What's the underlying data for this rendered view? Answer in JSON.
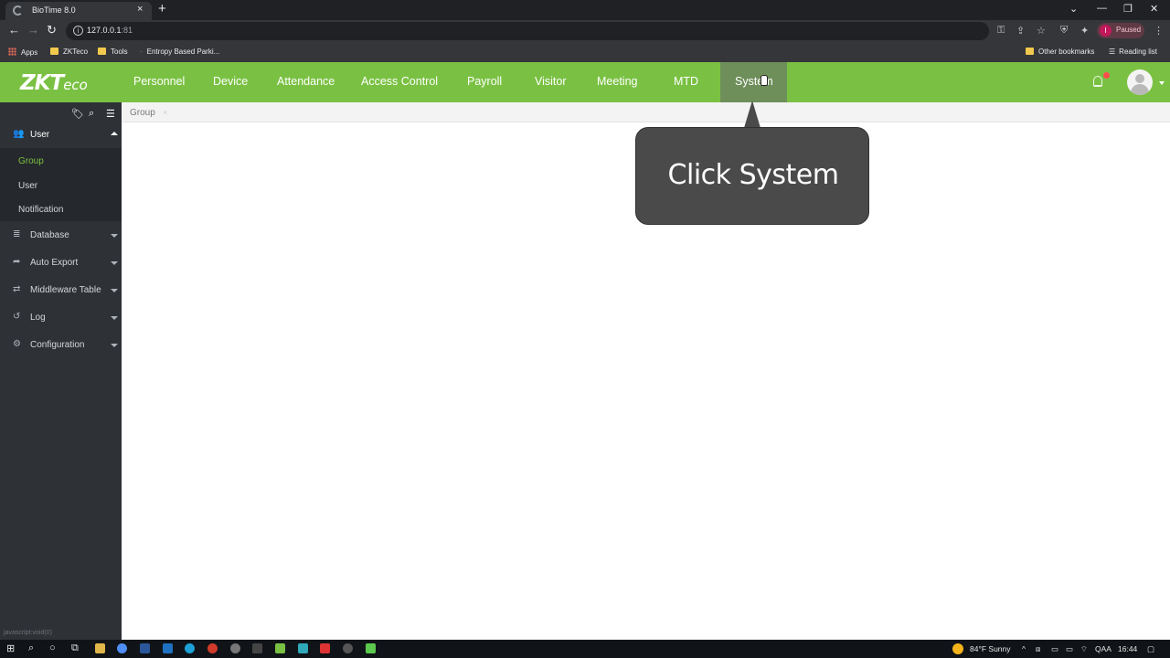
{
  "browser": {
    "tab_title": "BioTime 8.0",
    "tab_close": "×",
    "new_tab": "+",
    "url": "127.0.0.1",
    "url_port": ":81",
    "profile_initial": "I",
    "profile_status": "Paused",
    "bookmarks": [
      {
        "label": "Apps",
        "icon": "apps-grid-icon"
      },
      {
        "label": "ZKTeco",
        "icon": "folder-icon"
      },
      {
        "label": "Tools",
        "icon": "folder-icon"
      },
      {
        "label": "Entropy Based Parki...",
        "icon": "page-icon"
      }
    ],
    "other_bookmarks": "Other bookmarks",
    "reading_list": "Reading list"
  },
  "app": {
    "logo_main": "ZKT",
    "logo_tail": "eco",
    "menu": [
      "Personnel",
      "Device",
      "Attendance",
      "Access Control",
      "Payroll",
      "Visitor",
      "Meeting",
      "MTD",
      "System"
    ],
    "active_menu": "System",
    "accent_color": "#7ac143"
  },
  "sidebar": {
    "groups": [
      {
        "label": "User",
        "icon": "users-icon",
        "expanded": true,
        "items": [
          {
            "label": "Group",
            "active": true
          },
          {
            "label": "User"
          },
          {
            "label": "Notification"
          }
        ]
      },
      {
        "label": "Database",
        "icon": "database-icon"
      },
      {
        "label": "Auto Export",
        "icon": "export-icon"
      },
      {
        "label": "Middleware Table",
        "icon": "swap-icon"
      },
      {
        "label": "Log",
        "icon": "history-icon"
      },
      {
        "label": "Configuration",
        "icon": "gears-icon"
      }
    ]
  },
  "breadcrumb": {
    "current": "Group",
    "close": "×"
  },
  "callout": {
    "text": "Click System"
  },
  "status_hint": "javascript:void(0)",
  "taskbar": {
    "weather": "84°F  Sunny",
    "lang": "QAA",
    "time": "16:44"
  }
}
